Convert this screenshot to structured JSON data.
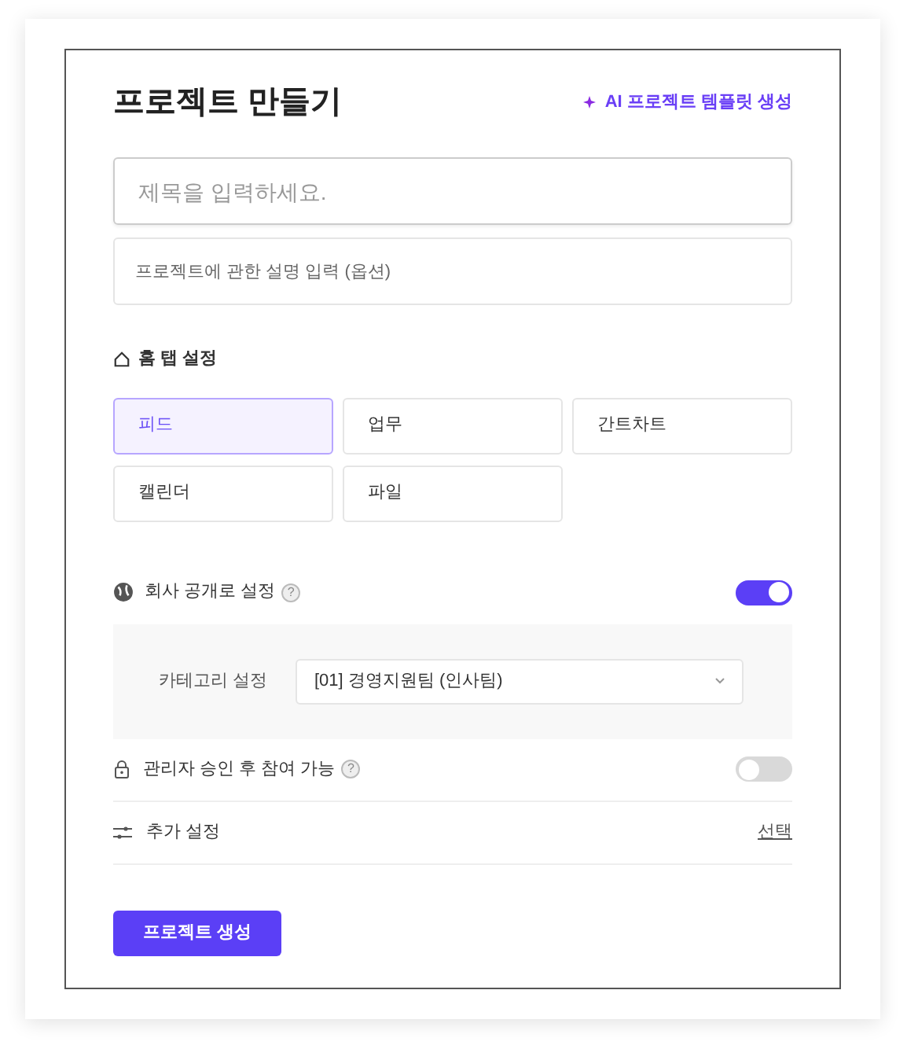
{
  "title": "프로젝트 만들기",
  "ai_link": "AI 프로젝트 템플릿 생성",
  "title_field": {
    "placeholder": "제목을 입력하세요."
  },
  "description_field": {
    "placeholder": "프로젝트에 관한 설명 입력 (옵션)"
  },
  "home_tab": {
    "heading": "홈 탭 설정",
    "options": [
      {
        "label": "피드",
        "selected": true
      },
      {
        "label": "업무",
        "selected": false
      },
      {
        "label": "간트차트",
        "selected": false
      },
      {
        "label": "캘린더",
        "selected": false
      },
      {
        "label": "파일",
        "selected": false
      }
    ]
  },
  "public_setting": {
    "label": "회사 공개로 설정",
    "help": "?",
    "on": true
  },
  "category": {
    "label": "카테고리 설정",
    "value": "[01] 경영지원팀 (인사팀)"
  },
  "approval_setting": {
    "label": "관리자 승인 후 참여 가능",
    "help": "?",
    "on": false
  },
  "extra_settings": {
    "label": "추가 설정",
    "link": "선택"
  },
  "submit_button": "프로젝트 생성"
}
